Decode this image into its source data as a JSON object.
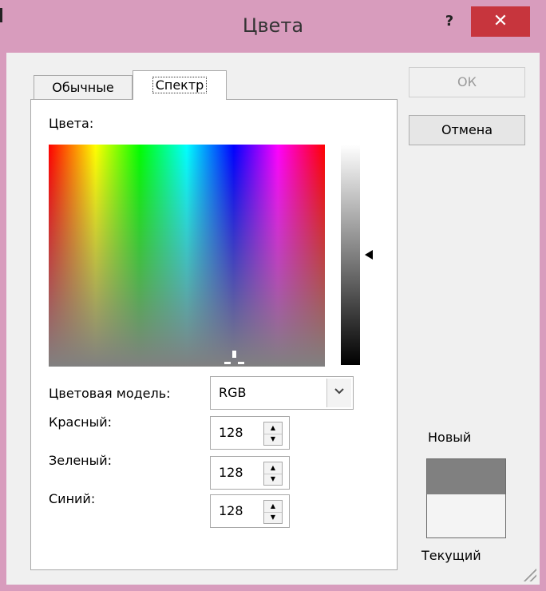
{
  "window": {
    "title": "Цвета",
    "help_label": "?",
    "close_label": "✕",
    "accent_color": "#d89cbd",
    "close_color": "#c7353d"
  },
  "tabs": [
    {
      "label": "Обычные",
      "selected": false
    },
    {
      "label": "Спектр",
      "selected": true
    }
  ],
  "spectrum": {
    "colors_label": "Цвета:",
    "luminance_slider_icon": "triangle-left-icon"
  },
  "color_model": {
    "label": "Цветовая модель:",
    "value": "RGB",
    "dropdown_icon": "chevron-down-icon"
  },
  "channels": [
    {
      "label": "Красный:",
      "value": "128"
    },
    {
      "label": "Зеленый:",
      "value": "128"
    },
    {
      "label": "Синий:",
      "value": "128"
    }
  ],
  "buttons": {
    "ok": "ОК",
    "cancel": "Отмена"
  },
  "preview": {
    "new_label": "Новый",
    "current_label": "Текущий",
    "new_color": "#808080",
    "current_color": "#f4f4f4"
  }
}
